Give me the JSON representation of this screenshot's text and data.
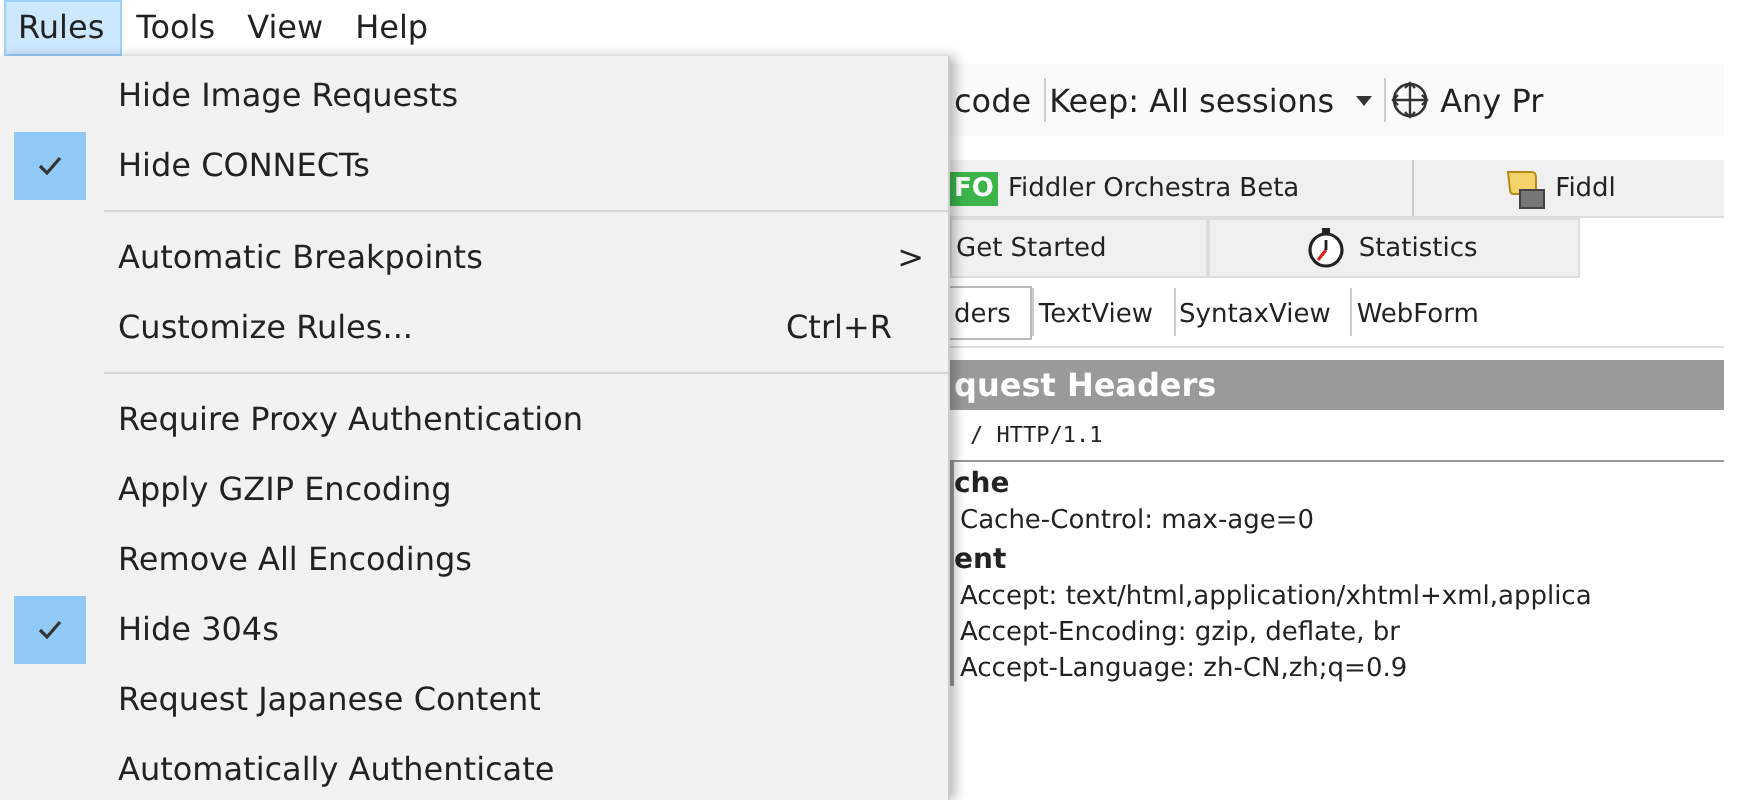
{
  "menu_bar": [
    {
      "label": "Rules",
      "selected": true
    },
    {
      "label": "Tools",
      "selected": false
    },
    {
      "label": "View",
      "selected": false
    },
    {
      "label": "Help",
      "selected": false
    }
  ],
  "dropdown": [
    {
      "kind": "item",
      "label": "Hide Image Requests",
      "checked": false
    },
    {
      "kind": "item",
      "label": "Hide CONNECTs",
      "checked": true
    },
    {
      "kind": "separator"
    },
    {
      "kind": "submenu",
      "label": "Automatic Breakpoints",
      "checked": false,
      "arrow": ">"
    },
    {
      "kind": "item",
      "label": "Customize Rules...",
      "checked": false,
      "shortcut": "Ctrl+R"
    },
    {
      "kind": "separator"
    },
    {
      "kind": "item",
      "label": "Require Proxy Authentication",
      "checked": false
    },
    {
      "kind": "item",
      "label": "Apply GZIP Encoding",
      "checked": false
    },
    {
      "kind": "item",
      "label": "Remove All Encodings",
      "checked": false
    },
    {
      "kind": "item",
      "label": "Hide 304s",
      "checked": true
    },
    {
      "kind": "item",
      "label": "Request Japanese Content",
      "checked": false
    },
    {
      "kind": "item",
      "label": "Automatically Authenticate",
      "checked": false
    }
  ],
  "toolbar": [
    {
      "kind": "text",
      "label": "code"
    },
    {
      "kind": "dropdown",
      "label": "Keep: All sessions"
    },
    {
      "kind": "target",
      "label": "Any Pr"
    }
  ],
  "tabs_row_1": [
    {
      "kind": "badge",
      "badge": "FO",
      "label": "Fiddler Orchestra Beta"
    },
    {
      "kind": "script",
      "label": "Fiddl"
    }
  ],
  "tabs_row_2": [
    {
      "kind": "plain",
      "label": "Get Started"
    },
    {
      "kind": "stopwatch",
      "label": "Statistics"
    }
  ],
  "inspector_tabs": [
    {
      "label": "ders",
      "selected": true
    },
    {
      "label": "TextView",
      "selected": false
    },
    {
      "label": "SyntaxView",
      "selected": false
    },
    {
      "label": "WebForm",
      "selected": false
    }
  ],
  "request_headers": {
    "title": "quest Headers",
    "request_line": "/ HTTP/1.1",
    "groups": [
      {
        "name": "che",
        "headers": [
          "Cache-Control: max-age=0"
        ]
      },
      {
        "name": "ent",
        "headers": [
          "Accept: text/html,application/xhtml+xml,applica",
          "Accept-Encoding: gzip, deflate, br",
          "Accept-Language: zh-CN,zh;q=0.9"
        ]
      }
    ]
  }
}
